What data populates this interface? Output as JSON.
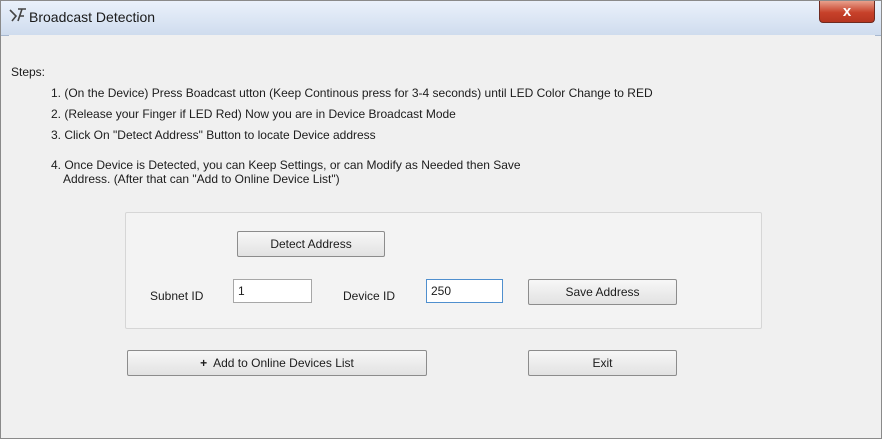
{
  "window": {
    "title": "Broadcast Detection",
    "close_label": "x"
  },
  "steps": {
    "heading": "Steps:",
    "step1": "1. (On the Device) Press Boadcast utton (Keep Continous press for 3-4 seconds) until LED Color Change to RED",
    "step2": "2. (Release your Finger if LED Red) Now you are in Device Broadcast Mode",
    "step3": "3. Click On \"Detect Address\" Button to locate Device address",
    "step4_line1": "4. Once Device is Detected, you can Keep Settings, or can Modify as Needed then Save",
    "step4_line2": "Address. (After that can \"Add to Online Device List\")"
  },
  "detect": {
    "button_label": "Detect Address",
    "subnet_label": "Subnet ID",
    "subnet_value": "1",
    "device_label": "Device ID",
    "device_value": "250",
    "save_label": "Save Address"
  },
  "actions": {
    "add_icon": "+",
    "add_label": "Add to Online Devices List",
    "exit_label": "Exit"
  }
}
